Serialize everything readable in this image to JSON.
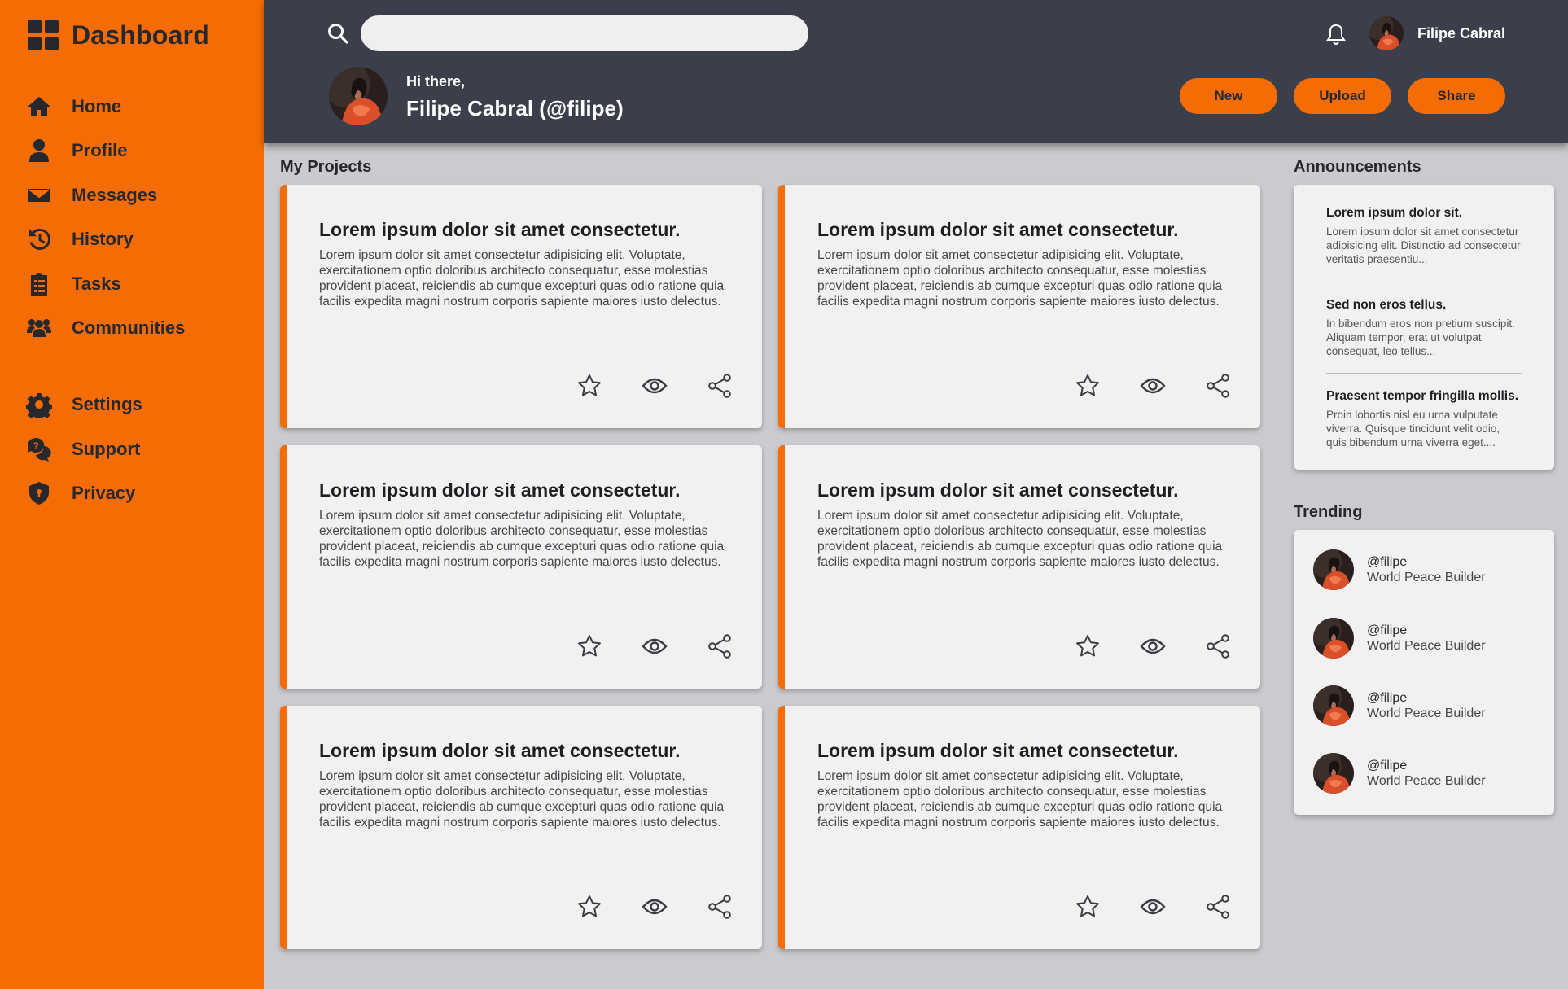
{
  "sidebar": {
    "brand": "Dashboard",
    "items": [
      {
        "label": "Home",
        "icon": "home-icon"
      },
      {
        "label": "Profile",
        "icon": "user-icon"
      },
      {
        "label": "Messages",
        "icon": "envelope-icon"
      },
      {
        "label": "History",
        "icon": "history-icon"
      },
      {
        "label": "Tasks",
        "icon": "clipboard-icon"
      },
      {
        "label": "Communities",
        "icon": "users-icon"
      },
      {
        "label": "Settings",
        "icon": "gear-icon"
      },
      {
        "label": "Support",
        "icon": "support-icon"
      },
      {
        "label": "Privacy",
        "icon": "shield-icon"
      }
    ]
  },
  "header": {
    "search_value": "",
    "user_name": "Filipe Cabral",
    "greeting": "Hi there,",
    "welcome_name": "Filipe Cabral (@filipe)",
    "buttons": {
      "new": "New",
      "upload": "Upload",
      "share": "Share"
    }
  },
  "projects": {
    "heading": "My Projects",
    "cards": [
      {
        "title": "Lorem ipsum dolor sit amet consectetur.",
        "body": "Lorem ipsum dolor sit amet consectetur adipisicing elit. Voluptate, exercitationem optio doloribus architecto consequatur, esse molestias provident placeat, reiciendis ab cumque excepturi quas odio ratione quia facilis expedita magni nostrum corporis sapiente maiores iusto delectus."
      },
      {
        "title": "Lorem ipsum dolor sit amet consectetur.",
        "body": "Lorem ipsum dolor sit amet consectetur adipisicing elit. Voluptate, exercitationem optio doloribus architecto consequatur, esse molestias provident placeat, reiciendis ab cumque excepturi quas odio ratione quia facilis expedita magni nostrum corporis sapiente maiores iusto delectus."
      },
      {
        "title": "Lorem ipsum dolor sit amet consectetur.",
        "body": "Lorem ipsum dolor sit amet consectetur adipisicing elit. Voluptate, exercitationem optio doloribus architecto consequatur, esse molestias provident placeat, reiciendis ab cumque excepturi quas odio ratione quia facilis expedita magni nostrum corporis sapiente maiores iusto delectus."
      },
      {
        "title": "Lorem ipsum dolor sit amet consectetur.",
        "body": "Lorem ipsum dolor sit amet consectetur adipisicing elit. Voluptate, exercitationem optio doloribus architecto consequatur, esse molestias provident placeat, reiciendis ab cumque excepturi quas odio ratione quia facilis expedita magni nostrum corporis sapiente maiores iusto delectus."
      },
      {
        "title": "Lorem ipsum dolor sit amet consectetur.",
        "body": "Lorem ipsum dolor sit amet consectetur adipisicing elit. Voluptate, exercitationem optio doloribus architecto consequatur, esse molestias provident placeat, reiciendis ab cumque excepturi quas odio ratione quia facilis expedita magni nostrum corporis sapiente maiores iusto delectus."
      },
      {
        "title": "Lorem ipsum dolor sit amet consectetur.",
        "body": "Lorem ipsum dolor sit amet consectetur adipisicing elit. Voluptate, exercitationem optio doloribus architecto consequatur, esse molestias provident placeat, reiciendis ab cumque excepturi quas odio ratione quia facilis expedita magni nostrum corporis sapiente maiores iusto delectus."
      }
    ]
  },
  "announcements": {
    "heading": "Announcements",
    "items": [
      {
        "title": "Lorem ipsum dolor sit.",
        "text": "Lorem ipsum dolor sit amet consectetur adipisicing elit. Distinctio ad consectetur veritatis praesentiu..."
      },
      {
        "title": "Sed non eros tellus.",
        "text": "In bibendum eros non pretium suscipit. Aliquam tempor, erat ut volutpat consequat, leo tellus..."
      },
      {
        "title": "Praesent tempor fringilla mollis.",
        "text": "Proin lobortis nisl eu urna vulputate viverra. Quisque tincidunt velit odio, quis bibendum urna viverra eget...."
      }
    ]
  },
  "trending": {
    "heading": "Trending",
    "items": [
      {
        "handle": "@filipe",
        "subtitle": "World Peace Builder"
      },
      {
        "handle": "@filipe",
        "subtitle": "World Peace Builder"
      },
      {
        "handle": "@filipe",
        "subtitle": "World Peace Builder"
      },
      {
        "handle": "@filipe",
        "subtitle": "World Peace Builder"
      }
    ]
  },
  "colors": {
    "accent": "#f56c02",
    "header_bg": "#3a3f4b",
    "page_bg": "#cbcbcf",
    "card_bg": "#f1f1f1"
  }
}
